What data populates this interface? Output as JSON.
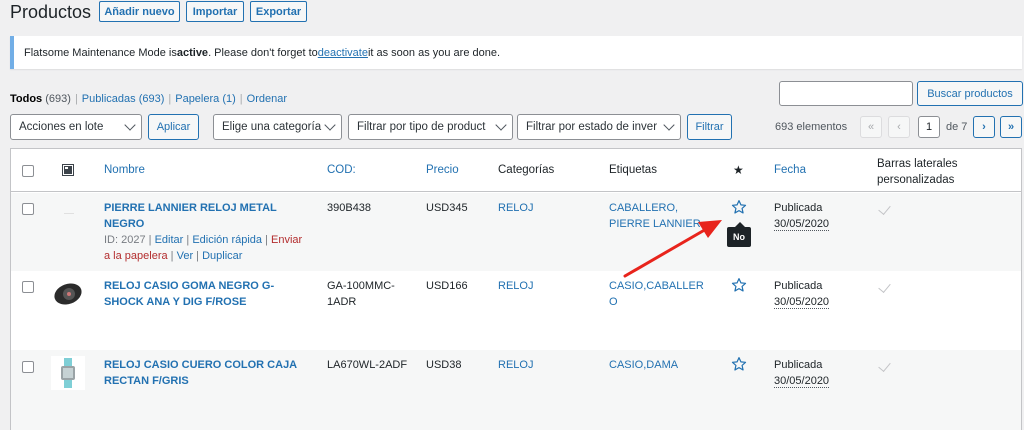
{
  "header": {
    "title": "Productos",
    "buttons": [
      "Añadir nuevo",
      "Importar",
      "Exportar"
    ]
  },
  "notice": {
    "pre": "Flatsome Maintenance Mode is ",
    "bold": "active",
    "mid": ". Please don't forget to ",
    "link": "deactivate",
    "post": " it as soon as you are done."
  },
  "views": [
    {
      "label": "Todos",
      "count": "(693)"
    },
    {
      "label": "Publicadas",
      "count": "(693)"
    },
    {
      "label": "Papelera",
      "count": "(1)"
    },
    {
      "label": "Ordenar",
      "count": ""
    }
  ],
  "search": {
    "button": "Buscar productos",
    "value": ""
  },
  "filters": {
    "bulk": "Acciones en lote",
    "apply": "Aplicar",
    "category": "Elige una categoría",
    "type": "Filtrar por tipo de product",
    "stock": "Filtrar por estado de inver",
    "filter": "Filtrar"
  },
  "pagination": {
    "count": "693 elementos",
    "first": "«",
    "prev": "‹",
    "current": "1",
    "of": "de 7",
    "next": "›",
    "last": "»"
  },
  "columns": {
    "name": "Nombre",
    "sku": "COD:",
    "price": "Precio",
    "categories": "Categorías",
    "tags": "Etiquetas",
    "featured": "★",
    "date": "Fecha",
    "sidebars_1": "Barras laterales",
    "sidebars_2": "personalizadas"
  },
  "rows": [
    {
      "name_1": "PIERRE LANNIER RELOJ METAL",
      "name_2": "NEGRO",
      "id": "ID: 2027",
      "edit": "Editar",
      "quick_edit": "Edición rápida",
      "trash_1": "Enviar",
      "trash_2": "a la papelera",
      "view": "Ver",
      "duplicate": "Duplicar",
      "sku": "390B438",
      "price": "USD345",
      "category": "RELOJ",
      "tags_1": "CABALLERO,",
      "tags_2": "PIERRE LANNIER",
      "status": "Publicada",
      "date": "30/05/2020"
    },
    {
      "name_1": "RELOJ CASIO GOMA NEGRO G-",
      "name_2": "SHOCK ANA Y DIG F/ROSE",
      "sku_1": "GA-100MMC-",
      "sku_2": "1ADR",
      "price": "USD166",
      "category": "RELOJ",
      "tags_1": "CASIO,CABALLER",
      "tags_2": "O",
      "status": "Publicada",
      "date": "30/05/2020"
    },
    {
      "name_1": "RELOJ CASIO CUERO COLOR CAJA",
      "name_2": "RECTAN F/GRIS",
      "sku": "LA670WL-2ADF",
      "price": "USD38",
      "category": "RELOJ",
      "tags_1": "CASIO,DAMA",
      "status": "Publicada",
      "date": "30/05/2020"
    }
  ],
  "tooltip": "No",
  "colors": {
    "accent": "#2271b1",
    "arrow": "#e8241c",
    "danger": "#b32d2e"
  }
}
